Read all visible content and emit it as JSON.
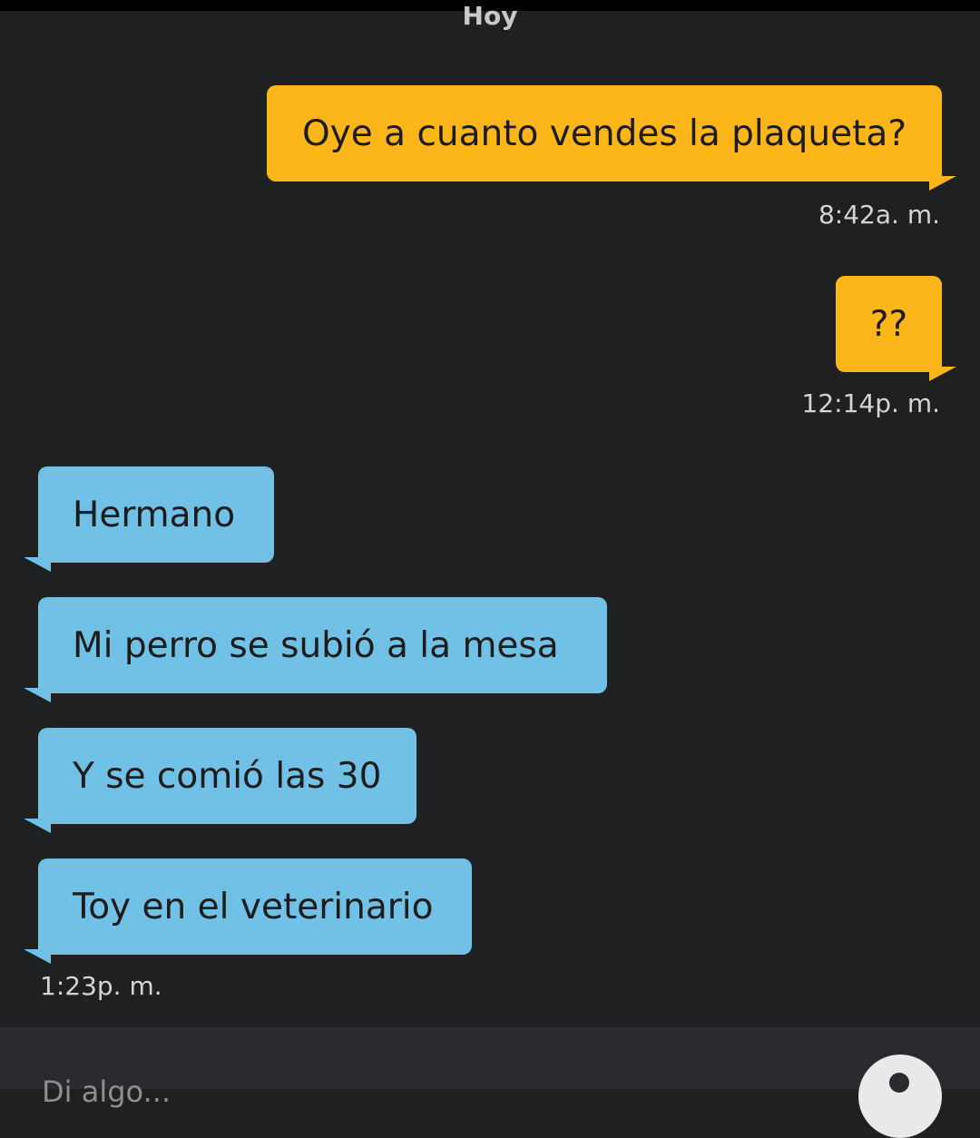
{
  "date_separator": "Hoy",
  "messages": [
    {
      "text": "Oye a cuanto vendes la plaqueta?",
      "direction": "outgoing"
    },
    {
      "text": "??",
      "direction": "outgoing"
    },
    {
      "text": "Hermano",
      "direction": "incoming"
    },
    {
      "text": "Mi perro se subió a la mesa",
      "direction": "incoming"
    },
    {
      "text": "Y se comió las 30",
      "direction": "incoming"
    },
    {
      "text": "Toy en el veterinario",
      "direction": "incoming"
    }
  ],
  "timestamps": {
    "t1": "8:42a. m.",
    "t2": "12:14p. m.",
    "t3": "1:23p. m."
  },
  "compose": {
    "placeholder": "Di algo..."
  },
  "colors": {
    "background": "#1f2022",
    "outgoing_bubble": "#fdb61a",
    "incoming_bubble": "#71c1e6"
  },
  "icons": {
    "compose_action": "circle-action-icon"
  }
}
